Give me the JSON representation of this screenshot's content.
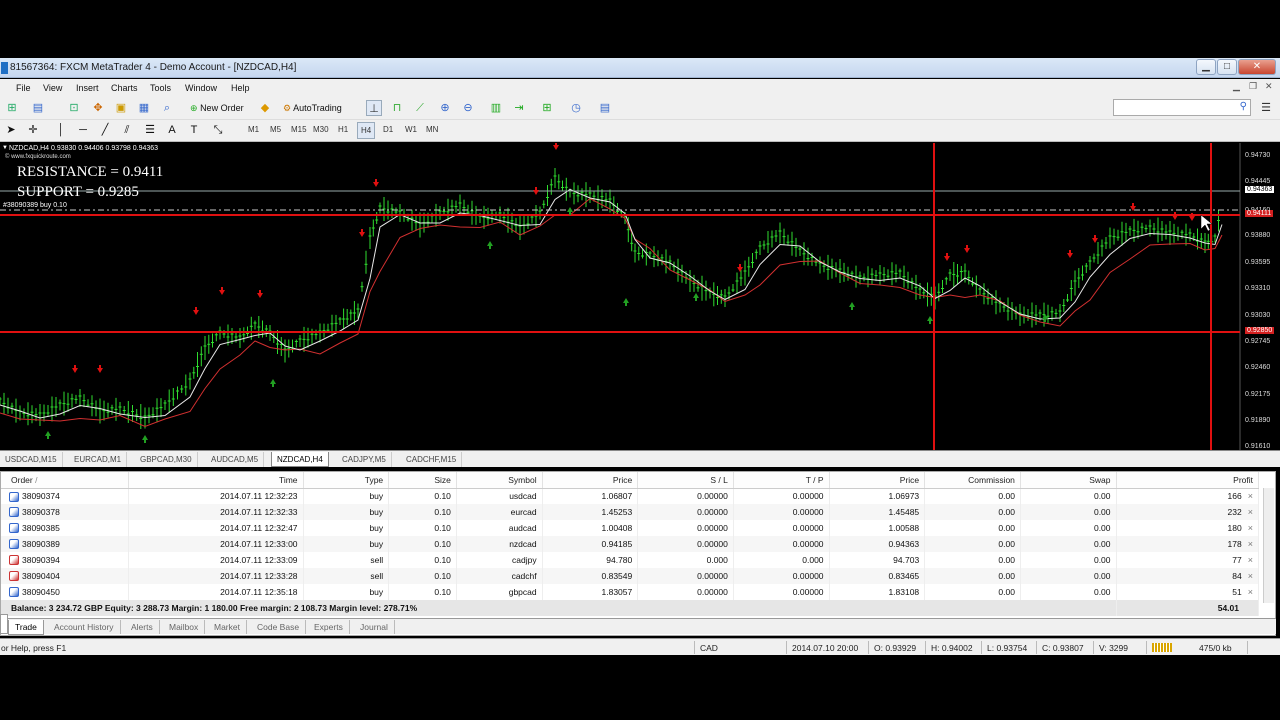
{
  "window": {
    "title": "81567364: FXCM MetaTrader 4 - Demo Account - [NZDCAD,H4]",
    "minimize": "▁",
    "maximize": "□",
    "close": "✕"
  },
  "menu": [
    "File",
    "View",
    "Insert",
    "Charts",
    "Tools",
    "Window",
    "Help"
  ],
  "toolbar": {
    "new_order": "New Order",
    "autotrading": "AutoTrading",
    "search_placeholder": ""
  },
  "timeframes": [
    "M1",
    "M5",
    "M15",
    "M30",
    "H1",
    "H4",
    "D1",
    "W1",
    "MN"
  ],
  "active_timeframe": "H4",
  "chart": {
    "header": "NZDCAD,H4  0.93830 0.94406 0.93798 0.94363",
    "watermark": "© www.fxquickroute.com",
    "resistance": "RESISTANCE  =  0.9411",
    "support": "SUPPORT  =  0.9285",
    "order_line": "#38090389 buy 0.10",
    "price_axis": [
      "0.94730",
      "0.94445",
      "0.94363",
      "0.94160",
      "0.94111",
      "0.93880",
      "0.93595",
      "0.93310",
      "0.93030",
      "0.92850",
      "0.92745",
      "0.92460",
      "0.92175",
      "0.91890",
      "0.91610"
    ],
    "bid_label": "0.94363",
    "resistance_label": "0.94111",
    "support_label": "0.92850",
    "colors": {
      "background": "#000000",
      "candles": "#2fdc2f",
      "fast_ma": "#e8e8e8",
      "slow_ma": "#d23030",
      "level_lines": "#e01010",
      "arrow_up": "#22a022",
      "arrow_down": "#e01010"
    }
  },
  "chart_tabs": [
    "USDCAD,M15",
    "EURCAD,M1",
    "GBPCAD,M30",
    "AUDCAD,M5",
    "NZDCAD,H4",
    "CADJPY,M5",
    "CADCHF,M15"
  ],
  "active_chart_tab": "NZDCAD,H4",
  "terminal": {
    "columns": [
      "Order",
      "/",
      "Time",
      "Type",
      "Size",
      "Symbol",
      "Price",
      "S / L",
      "T / P",
      "Price",
      "Commission",
      "Swap",
      "Profit"
    ],
    "rows": [
      {
        "order": "38090374",
        "time": "2014.07.11 12:32:23",
        "type": "buy",
        "size": "0.10",
        "symbol": "usdcad",
        "price": "1.06807",
        "sl": "0.00000",
        "tp": "0.00000",
        "cur": "1.06973",
        "comm": "0.00",
        "swap": "0.00",
        "profit": "166"
      },
      {
        "order": "38090378",
        "time": "2014.07.11 12:32:33",
        "type": "buy",
        "size": "0.10",
        "symbol": "eurcad",
        "price": "1.45253",
        "sl": "0.00000",
        "tp": "0.00000",
        "cur": "1.45485",
        "comm": "0.00",
        "swap": "0.00",
        "profit": "232"
      },
      {
        "order": "38090385",
        "time": "2014.07.11 12:32:47",
        "type": "buy",
        "size": "0.10",
        "symbol": "audcad",
        "price": "1.00408",
        "sl": "0.00000",
        "tp": "0.00000",
        "cur": "1.00588",
        "comm": "0.00",
        "swap": "0.00",
        "profit": "180"
      },
      {
        "order": "38090389",
        "time": "2014.07.11 12:33:00",
        "type": "buy",
        "size": "0.10",
        "symbol": "nzdcad",
        "price": "0.94185",
        "sl": "0.00000",
        "tp": "0.00000",
        "cur": "0.94363",
        "comm": "0.00",
        "swap": "0.00",
        "profit": "178"
      },
      {
        "order": "38090394",
        "time": "2014.07.11 12:33:09",
        "type": "sell",
        "size": "0.10",
        "symbol": "cadjpy",
        "price": "94.780",
        "sl": "0.000",
        "tp": "0.000",
        "cur": "94.703",
        "comm": "0.00",
        "swap": "0.00",
        "profit": "77"
      },
      {
        "order": "38090404",
        "time": "2014.07.11 12:33:28",
        "type": "sell",
        "size": "0.10",
        "symbol": "cadchf",
        "price": "0.83549",
        "sl": "0.00000",
        "tp": "0.00000",
        "cur": "0.83465",
        "comm": "0.00",
        "swap": "0.00",
        "profit": "84"
      },
      {
        "order": "38090450",
        "time": "2014.07.11 12:35:18",
        "type": "buy",
        "size": "0.10",
        "symbol": "gbpcad",
        "price": "1.83057",
        "sl": "0.00000",
        "tp": "0.00000",
        "cur": "1.83108",
        "comm": "0.00",
        "swap": "0.00",
        "profit": "51"
      }
    ],
    "balance_line": "Balance: 3 234.72 GBP  Equity: 3 288.73  Margin: 1 180.00  Free margin: 2 108.73  Margin level: 278.71%",
    "total_profit": "54.01",
    "close_glyph": "×"
  },
  "terminal_tabs": [
    "Trade",
    "Account History",
    "Alerts",
    "Mailbox",
    "Market",
    "Code Base",
    "Experts",
    "Journal"
  ],
  "active_terminal_tab": "Trade",
  "status": {
    "help": "or Help, press F1",
    "profile": "CAD",
    "datetime": "2014.07.10 20:00",
    "open": "O: 0.93929",
    "high": "H: 0.94002",
    "low": "L: 0.93754",
    "close": "C: 0.93807",
    "volume": "V: 3299",
    "traffic": "475/0 kb"
  }
}
